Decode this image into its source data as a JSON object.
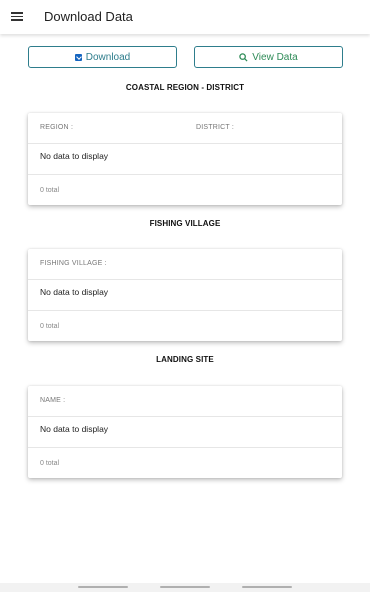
{
  "appbar": {
    "title": "Download Data",
    "menu_icon": "hamburger-menu-icon"
  },
  "actions": {
    "download_label": "Download",
    "download_icon": "download-icon",
    "view_label": "View Data",
    "view_icon": "search-icon"
  },
  "sections": {
    "coastal": {
      "title": "COASTAL REGION - DISTRICT",
      "columns": [
        "REGION :",
        "DISTRICT :"
      ],
      "empty": "No data to display",
      "total": "0 total"
    },
    "fishing": {
      "title": "FISHING VILLAGE",
      "columns": [
        "FISHING VILLAGE :"
      ],
      "empty": "No data to display",
      "total": "0 total"
    },
    "landing": {
      "title": "LANDING SITE",
      "columns": [
        "NAME :"
      ],
      "empty": "No data to display",
      "total": "0 total"
    }
  },
  "colors": {
    "accent": "#2e7d8c",
    "download_icon": "#1565c0",
    "view_text": "#2e8b57"
  }
}
